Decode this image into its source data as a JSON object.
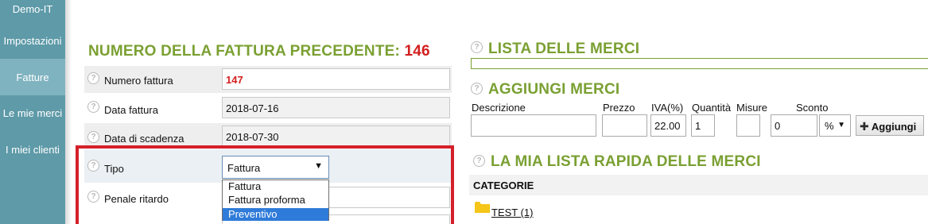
{
  "sidebar": {
    "items": [
      {
        "label": "Demo-IT"
      },
      {
        "label": "Impostazioni"
      },
      {
        "label": "Fatture",
        "active": true
      },
      {
        "label": "Le mie merci"
      },
      {
        "label": "I miei clienti"
      }
    ]
  },
  "invoice": {
    "heading": "NUMERO DELLA FATTURA PRECEDENTE:",
    "previous_number": "146",
    "help_glyph": "?",
    "fields": {
      "numero": {
        "label": "Numero fattura",
        "value": "147"
      },
      "data": {
        "label": "Data fattura",
        "value": "2018-07-16"
      },
      "scadenza": {
        "label": "Data di scadenza",
        "value": "2018-07-30"
      },
      "tipo": {
        "label": "Tipo",
        "value": "Fattura",
        "options": [
          "Fattura",
          "Fattura proforma",
          "Preventivo"
        ],
        "highlighted": "Preventivo"
      },
      "penale": {
        "label": "Penale ritardo",
        "value": ""
      }
    }
  },
  "goods_list": {
    "heading": "LISTA DELLE MERCI"
  },
  "add_goods": {
    "heading": "AGGIUNGI MERCI",
    "columns": {
      "descrizione": "Descrizione",
      "prezzo": "Prezzo",
      "iva": "IVA(%)",
      "quantita": "Quantità",
      "misure": "Misure",
      "sconto": "Sconto"
    },
    "values": {
      "descrizione": "",
      "prezzo": "",
      "iva": "22.00",
      "quantita": "1",
      "misure": "",
      "sconto": "0",
      "sconto_unit": "%"
    },
    "add_button": "Aggiungi"
  },
  "quick_list": {
    "heading": "LA MIA LISTA RAPIDA DELLE MERCI",
    "categories_label": "CATEGORIE",
    "categories": [
      {
        "label": "TEST (1)"
      }
    ]
  },
  "colors": {
    "accent_green": "#7aa032",
    "sidebar": "#5e9aa8",
    "highlight_red": "#d21f1f",
    "frame_red": "#d4202a"
  }
}
